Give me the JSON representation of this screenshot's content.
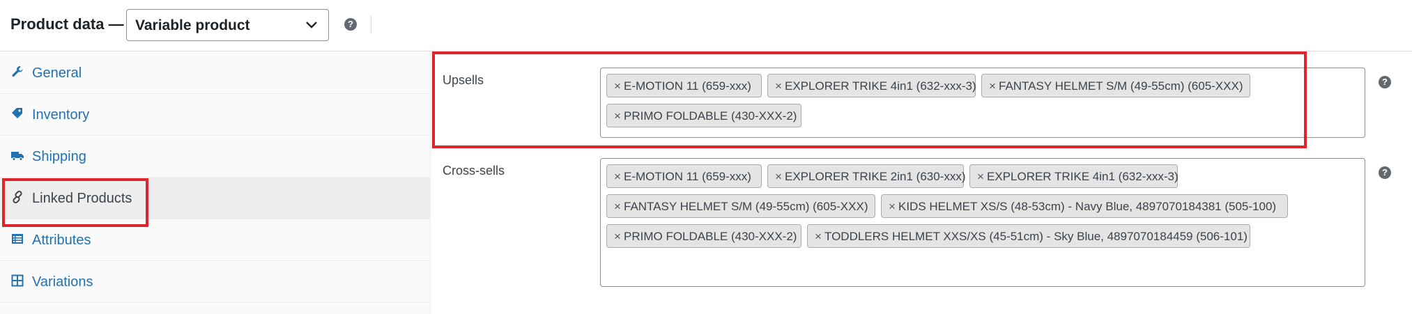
{
  "header": {
    "title": "Product data —",
    "product_type": "Variable product",
    "help_glyph": "?"
  },
  "sidebar": {
    "items": [
      {
        "label": "General",
        "icon": "wrench-icon"
      },
      {
        "label": "Inventory",
        "icon": "tag-icon"
      },
      {
        "label": "Shipping",
        "icon": "truck-icon"
      },
      {
        "label": "Linked Products",
        "icon": "link-icon",
        "active": true
      },
      {
        "label": "Attributes",
        "icon": "list-icon"
      },
      {
        "label": "Variations",
        "icon": "grid-icon"
      }
    ]
  },
  "upsells": {
    "label": "Upsells",
    "remove_glyph": "×",
    "items": [
      "E-MOTION 11 (659-xxx)",
      "EXPLORER TRIKE 4in1 (632-xxx-3)",
      "FANTASY HELMET S/M (49-55cm) (605-XXX)",
      "PRIMO FOLDABLE (430-XXX-2)"
    ]
  },
  "crosssells": {
    "label": "Cross-sells",
    "remove_glyph": "×",
    "items": [
      "E-MOTION 11 (659-xxx)",
      "EXPLORER TRIKE 2in1 (630-xxx)",
      "EXPLORER TRIKE 4in1 (632-xxx-3)",
      "FANTASY HELMET S/M (49-55cm) (605-XXX)",
      "KIDS HELMET XS/S (48-53cm) - Navy Blue, 4897070184381 (505-100)",
      "PRIMO FOLDABLE (430-XXX-2)",
      "TODDLERS HELMET XXS/XS (45-51cm) - Sky Blue, 4897070184459 (506-101)"
    ]
  },
  "colors": {
    "link": "#2271b1",
    "highlight": "#e0242b",
    "chip_bg": "#e4e4e4"
  }
}
